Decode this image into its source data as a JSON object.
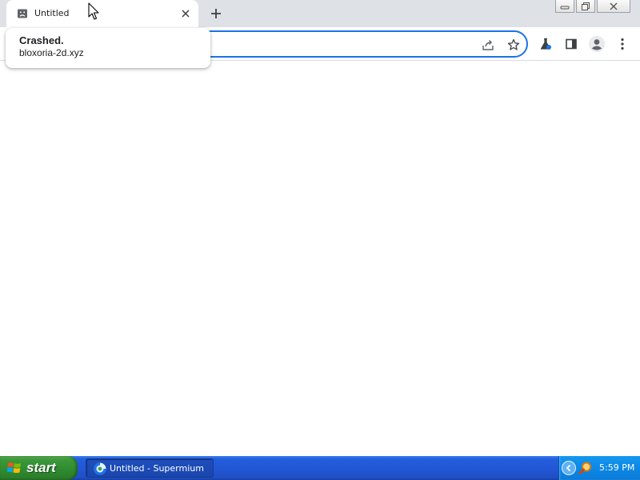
{
  "browser": {
    "tab": {
      "title": "Untitled",
      "favicon": "sad-tab-icon"
    },
    "new_tab_icon": "plus-icon",
    "caption_buttons": [
      "minimize-icon",
      "restore-icon",
      "close-icon"
    ],
    "toolbar_icons": [
      "share-icon",
      "star-icon",
      "labs-flask-icon",
      "side-panel-icon",
      "profile-icon",
      "kebab-menu-icon"
    ],
    "hovercard": {
      "title": "Crashed.",
      "domain": "bloxoria-2d.xyz"
    },
    "colors": {
      "accent": "#1a73e8",
      "tabstrip": "#dee1e6"
    }
  },
  "taskbar": {
    "start_label": "start",
    "task_items": [
      {
        "label": "Untitled - Supermium",
        "icon": "supermium-icon"
      }
    ],
    "clock": "5:59 PM"
  }
}
